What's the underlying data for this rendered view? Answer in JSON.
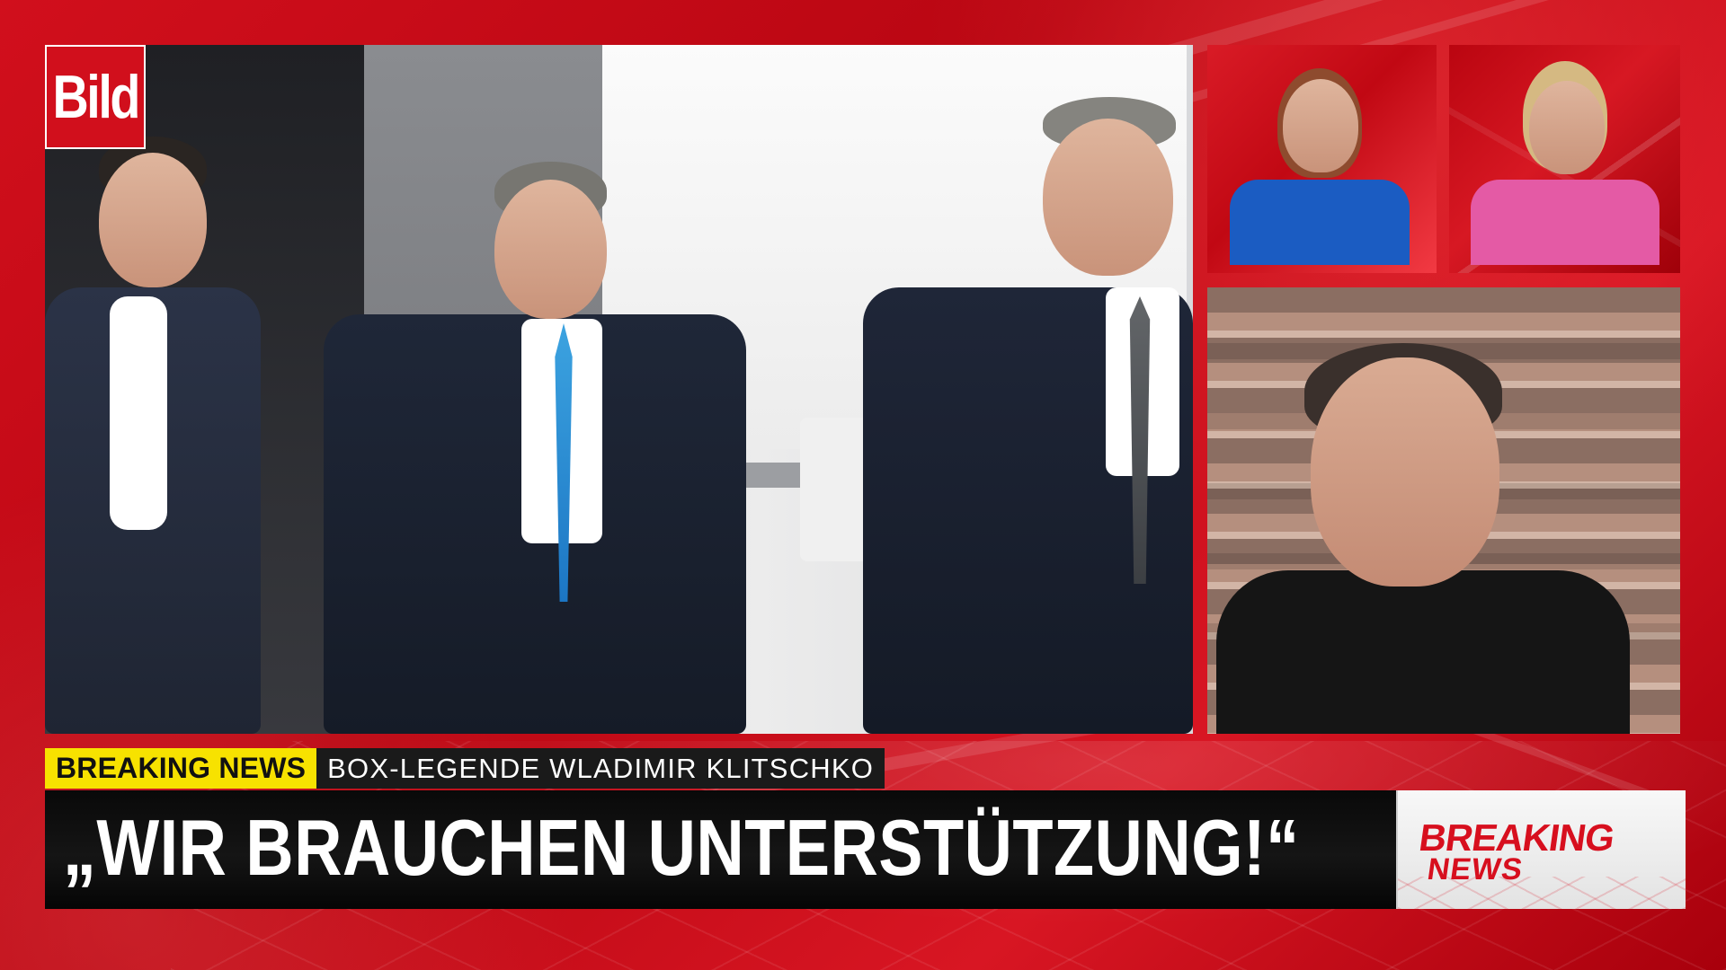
{
  "brand": {
    "logo_text": "Bild",
    "accent_red": "#d10f1c",
    "yellow": "#f7e200",
    "black": "#111111"
  },
  "lower_third": {
    "label": "BREAKING NEWS",
    "subtitle": "BOX-LEGENDE WLADIMIR KLITSCHKO",
    "headline": "„WIR BRAUCHEN UNTERSTÜTZUNG!“",
    "badge_line_1": "BREAKING",
    "badge_line_2": "NEWS"
  }
}
